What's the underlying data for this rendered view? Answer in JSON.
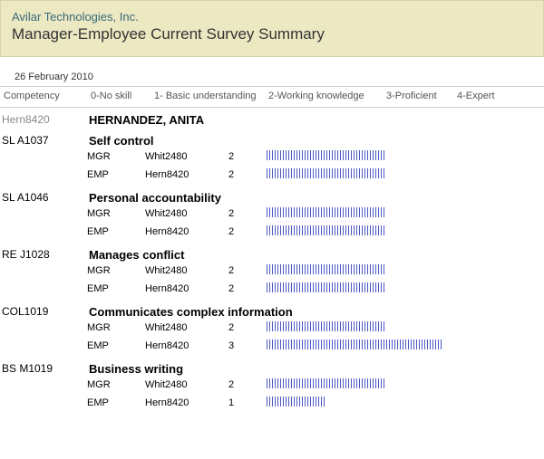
{
  "header": {
    "company": "Avilar Technologies, Inc.",
    "title": "Manager-Employee Current Survey Summary"
  },
  "date": "26 February 2010",
  "legend": {
    "competency": "Competency",
    "l0": "0-No skill",
    "l1": "1- Basic understanding",
    "l2": "2-Working knowledge",
    "l3": "3-Proficient",
    "l4": "4-Expert"
  },
  "employee": {
    "code": "Hern8420",
    "name": "HERNANDEZ, ANITA"
  },
  "competencies": [
    {
      "code": "SL A1037",
      "name": "Self control",
      "ratings": [
        {
          "role": "MGR",
          "rater": "Whit2480",
          "score": "2",
          "barClass": "s2"
        },
        {
          "role": "EMP",
          "rater": "Hern8420",
          "score": "2",
          "barClass": "s2"
        }
      ]
    },
    {
      "code": "SL A1046",
      "name": "Personal accountability",
      "ratings": [
        {
          "role": "MGR",
          "rater": "Whit2480",
          "score": "2",
          "barClass": "s2"
        },
        {
          "role": "EMP",
          "rater": "Hern8420",
          "score": "2",
          "barClass": "s2"
        }
      ]
    },
    {
      "code": "RE J1028",
      "name": "Manages conflict",
      "ratings": [
        {
          "role": "MGR",
          "rater": "Whit2480",
          "score": "2",
          "barClass": "s2"
        },
        {
          "role": "EMP",
          "rater": "Hern8420",
          "score": "2",
          "barClass": "s2"
        }
      ]
    },
    {
      "code": "COL1019",
      "name": "Communicates complex information",
      "ratings": [
        {
          "role": "MGR",
          "rater": "Whit2480",
          "score": "2",
          "barClass": "s2"
        },
        {
          "role": "EMP",
          "rater": "Hern8420",
          "score": "3",
          "barClass": "s3"
        }
      ]
    },
    {
      "code": "BS M1019",
      "name": "Business writing",
      "ratings": [
        {
          "role": "MGR",
          "rater": "Whit2480",
          "score": "2",
          "barClass": "s2"
        },
        {
          "role": "EMP",
          "rater": "Hern8420",
          "score": "1",
          "barClass": "s1"
        }
      ]
    }
  ],
  "chart_data": {
    "type": "table",
    "title": "Manager-Employee Current Survey Summary",
    "scale": {
      "min": 0,
      "max": 4,
      "labels": [
        "No skill",
        "Basic understanding",
        "Working knowledge",
        "Proficient",
        "Expert"
      ]
    },
    "employee": "HERNANDEZ, ANITA",
    "series": [
      {
        "name": "Self control",
        "values": {
          "MGR": 2,
          "EMP": 2
        }
      },
      {
        "name": "Personal accountability",
        "values": {
          "MGR": 2,
          "EMP": 2
        }
      },
      {
        "name": "Manages conflict",
        "values": {
          "MGR": 2,
          "EMP": 2
        }
      },
      {
        "name": "Communicates complex information",
        "values": {
          "MGR": 2,
          "EMP": 3
        }
      },
      {
        "name": "Business writing",
        "values": {
          "MGR": 2,
          "EMP": 1
        }
      }
    ]
  }
}
